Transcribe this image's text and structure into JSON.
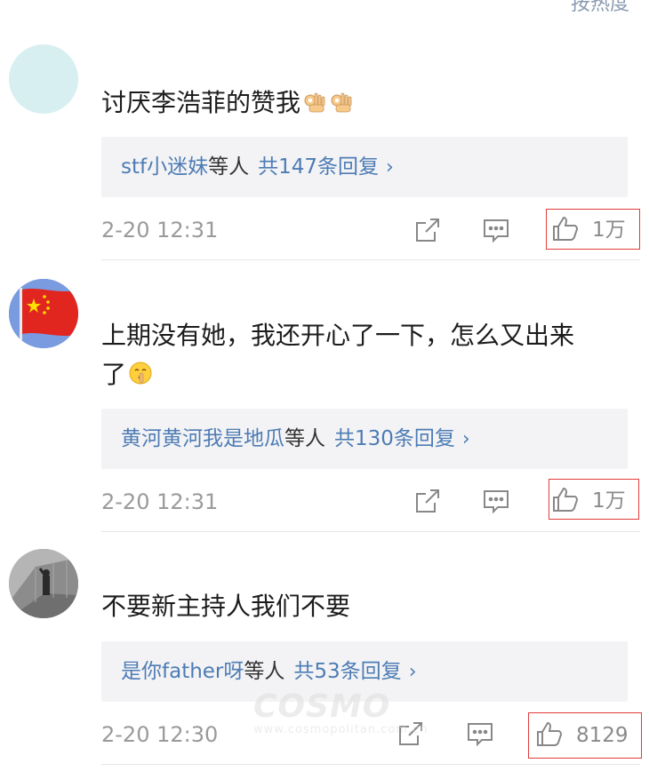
{
  "header": {
    "sort_label": "按热度"
  },
  "comments": [
    {
      "text": "讨厌李浩菲的赞我",
      "emoji": "ok-hand-emoji",
      "reply_names": "stf小迷妹",
      "reply_deng": "等人",
      "reply_total": "共147条回复",
      "time": "2-20 12:31",
      "likes": "1万"
    },
    {
      "text_line1": "上期没有她，我还开心了一下，怎么又出来",
      "text_line2": "了",
      "emoji": "shushing-face-emoji",
      "reply_names": "黄河黄河我是地瓜",
      "reply_deng": "等人",
      "reply_total": "共130条回复",
      "time": "2-20 12:31",
      "likes": "1万"
    },
    {
      "text": "不要新主持人我们不要",
      "reply_names": "是你father呀",
      "reply_deng": "等人",
      "reply_total": "共53条回复",
      "time": "2-20 12:30",
      "likes": "8129"
    }
  ],
  "watermark": {
    "logo": "COSMO",
    "url": "www.cosmopolitan.com.cn"
  },
  "colors": {
    "link": "#4d7cb4",
    "highlight": "#e23b3b",
    "reply_bg": "#f3f3f5"
  }
}
